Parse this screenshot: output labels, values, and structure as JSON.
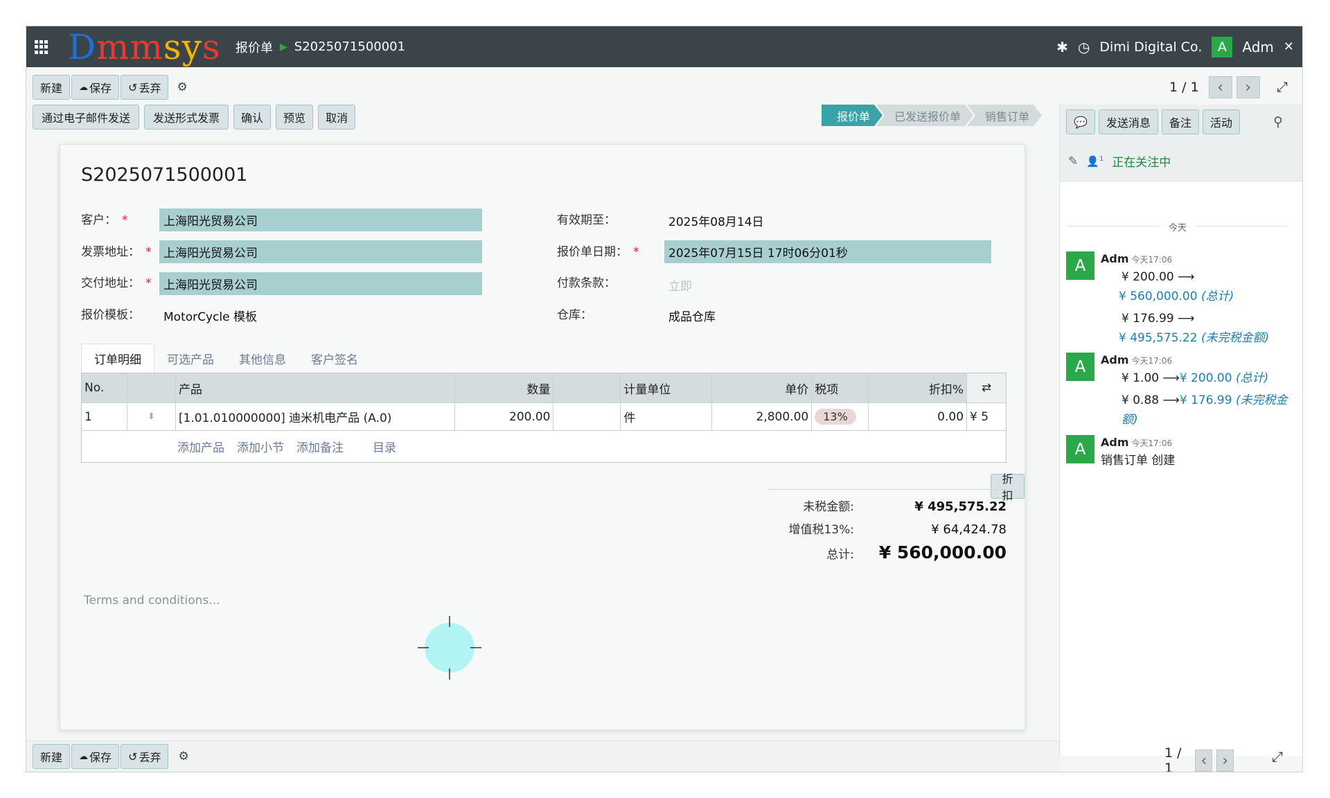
{
  "navbar": {
    "logo": [
      "D",
      "mm",
      "sy",
      "s"
    ],
    "breadcrumb_parent": "报价单",
    "breadcrumb_current": "S2025071500001",
    "company": "Dimi Digital Co.",
    "user_initial": "A",
    "user_name": "Adm",
    "icons": [
      "apps-grid-icon",
      "bug-icon",
      "clock-icon",
      "fullscreen-icon"
    ]
  },
  "toolbar": {
    "new": "新建",
    "save": "保存",
    "discard": "丢弃",
    "pager": "1 / 1"
  },
  "actions": [
    "通过电子邮件发送",
    "发送形式发票",
    "确认",
    "预览",
    "取消"
  ],
  "stages": [
    {
      "label": "报价单",
      "active": true
    },
    {
      "label": "已发送报价单",
      "active": false
    },
    {
      "label": "销售订单",
      "active": false
    }
  ],
  "form": {
    "title": "S2025071500001",
    "customer_label": "客户：",
    "customer": "上海阳光贸易公司",
    "invoice_addr_label": "发票地址：",
    "invoice_addr": "上海阳光贸易公司",
    "delivery_addr_label": "交付地址：",
    "delivery_addr": "上海阳光贸易公司",
    "template_label": "报价模板：",
    "template": "MotorCycle 模板",
    "validity_label": "有效期至：",
    "validity": "2025年08月14日",
    "quote_date_label": "报价单日期：",
    "quote_date": "2025年07月15日 17时06分01秒",
    "payment_terms_label": "付款条款：",
    "payment_terms_placeholder": "立即",
    "warehouse_label": "仓库：",
    "warehouse": "成品仓库",
    "required_mark": "*"
  },
  "tabs": [
    "订单明细",
    "可选产品",
    "其他信息",
    "客户签名"
  ],
  "lines": {
    "headers": {
      "no": "No.",
      "product": "产品",
      "qty": "数量",
      "uom": "计量单位",
      "price": "单价",
      "tax": "税项",
      "discount": "折扣%"
    },
    "rows": [
      {
        "no": "1",
        "product": "[1.01.010000000] 迪米机电产品 (A.0)",
        "qty": "200.00",
        "uom": "件",
        "price": "2,800.00",
        "tax": "13%",
        "discount": "0.00",
        "subtotal": "¥ 5"
      }
    ],
    "add_product": "添加产品",
    "add_section": "添加小节",
    "add_note": "添加备注",
    "catalog": "目录"
  },
  "discount_button": "折扣",
  "totals": {
    "untaxed_label": "未税金额:",
    "untaxed": "¥ 495,575.22",
    "vat_label": "增值税13%:",
    "vat": "¥ 64,424.78",
    "total_label": "总计:",
    "total": "¥ 560,000.00"
  },
  "terms_placeholder": "Terms and conditions...",
  "chatter": {
    "send_message": "发送消息",
    "log_note": "备注",
    "activity": "活动",
    "follower_count": "1",
    "following": "正在关注中",
    "today": "今天",
    "messages": [
      {
        "author": "Adm",
        "time": "今天17:06",
        "lines": [
          {
            "old": "¥ 200.00",
            "new": "¥ 560,000.00",
            "field": "(总计)"
          },
          {
            "old": "¥ 176.99",
            "new": "¥ 495,575.22",
            "field": "(未完税金额)"
          }
        ]
      },
      {
        "author": "Adm",
        "time": "今天17:06",
        "lines": [
          {
            "old": "¥ 1.00",
            "new": "¥ 200.00",
            "field": "(总计)"
          },
          {
            "old": "¥ 0.88",
            "new": "¥ 176.99",
            "field": "(未完税金额)"
          }
        ]
      },
      {
        "author": "Adm",
        "time": "今天17:06",
        "text": "销售订单 创建"
      }
    ],
    "arrow": "⟶"
  },
  "colors": {
    "navbar": "#3b4449",
    "accent": "#3aa3a8",
    "field_bg": "#a8cfd0",
    "avatar": "#2aa84a",
    "required": "#e02020"
  }
}
